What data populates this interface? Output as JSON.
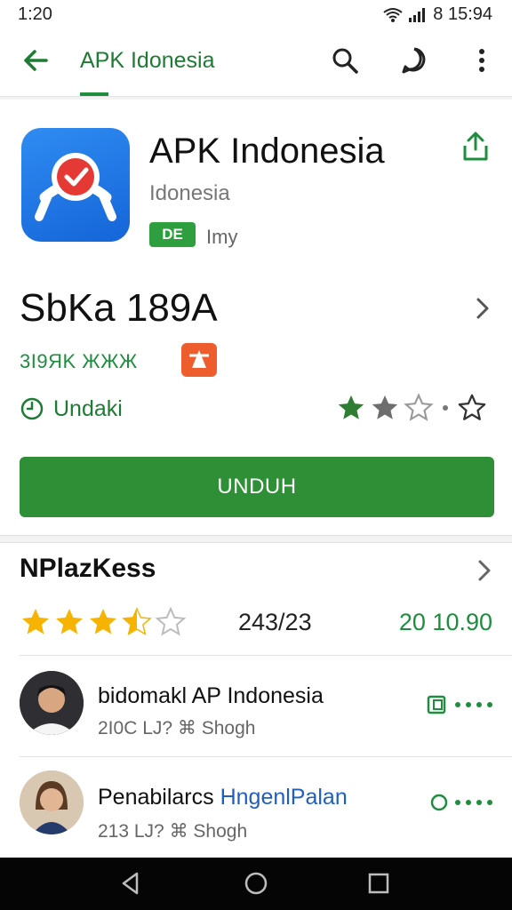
{
  "status_bar": {
    "time": "1:20",
    "right_text": "8 15:94"
  },
  "app_bar": {
    "title": "APK Idonesia"
  },
  "app": {
    "name": "APK Indonesia",
    "subtitle": "Idonesia",
    "badge": "DE",
    "badge_text": "Imy",
    "version": "SbKa 189A",
    "tagline": "3I9ЯK ЖЖЖ",
    "update_label": "Undaki",
    "rating_stars": 2,
    "download_button": "UNDUH",
    "colors": {
      "primary_green": "#2e8f36",
      "accent_green": "#1e8e3e",
      "blue": "#1f5fbf",
      "orange": "#ee5d2e"
    }
  },
  "reviews_section": {
    "title": "NPlazKess",
    "rating_stars": 3.5,
    "count": "243/23",
    "number": "20 10.90",
    "items": [
      {
        "name": "bidomakl AP Indonesia",
        "meta": "2I0C LJ? ⌘ Shogh",
        "action_icon": "rating-badge-icon"
      },
      {
        "name_part1": "Penabilarcs ",
        "name_part2": "HngenlPalan",
        "meta": "213 LJ? ⌘ Shogh",
        "action_icon": "circle-icon"
      }
    ]
  }
}
